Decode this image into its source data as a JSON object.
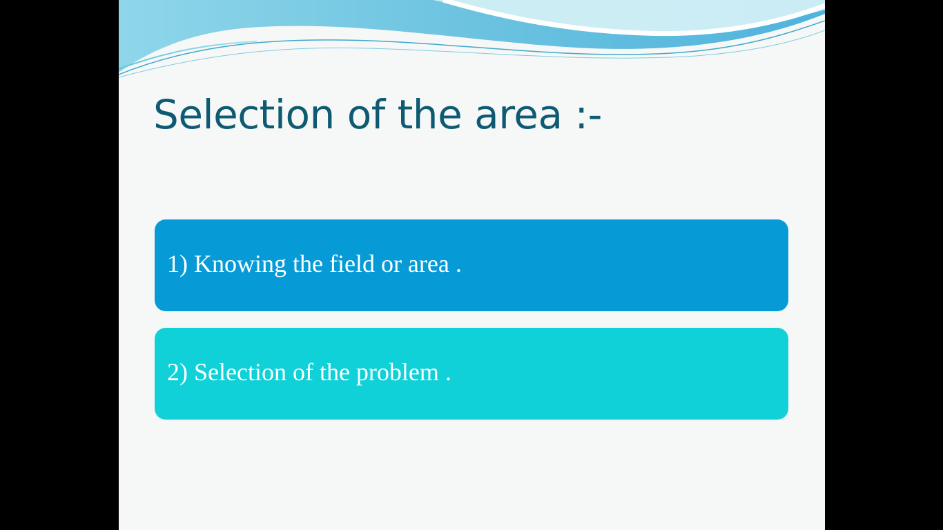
{
  "slide": {
    "title": "Selection of the area :-",
    "items": [
      {
        "label": "1) Knowing the field or area ."
      },
      {
        "label": "2) Selection of the problem ."
      }
    ]
  },
  "colors": {
    "background_frame": "#000000",
    "slide_background": "#f6f7f7",
    "title_text": "#0e5a72",
    "item_1_fill": "#069bd6",
    "item_2_fill": "#10d0d8",
    "item_text": "#ffffff",
    "wave_primary": "#6fc7e3",
    "wave_light": "#bfe8f3"
  }
}
